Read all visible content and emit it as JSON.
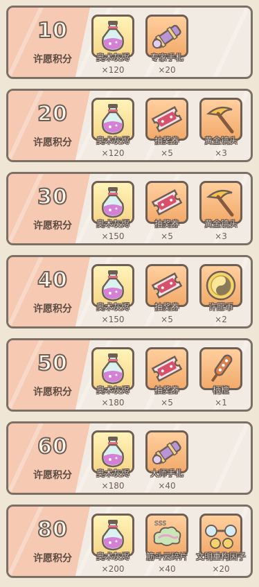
{
  "colors": {
    "panel_border": "#7b6f66",
    "panel_bg": "#f2ebe3",
    "accent_left": "#f5c9b2",
    "gold_box": "#f6d78a",
    "orange_box": "#f2aa6b"
  },
  "tier_label": "许愿积分",
  "tiers": [
    {
      "points": "10",
      "label": "许愿积分",
      "rewards": [
        {
          "name": "奥术灰烬",
          "qty": "×120",
          "icon": "potion-bottle-icon",
          "box": "gold"
        },
        {
          "name": "专家手札",
          "qty": "×20",
          "icon": "scroll-telescope-icon",
          "box": "orange"
        }
      ]
    },
    {
      "points": "20",
      "label": "许愿积分",
      "rewards": [
        {
          "name": "奥术灰烬",
          "qty": "×120",
          "icon": "potion-bottle-icon",
          "box": "gold"
        },
        {
          "name": "抽奖券",
          "qty": "×5",
          "icon": "ticket-icon",
          "box": "orange"
        },
        {
          "name": "黄金镐头",
          "qty": "×3",
          "icon": "pickaxe-icon",
          "box": "orange"
        }
      ]
    },
    {
      "points": "30",
      "label": "许愿积分",
      "rewards": [
        {
          "name": "奥术灰烬",
          "qty": "×150",
          "icon": "potion-bottle-icon",
          "box": "gold"
        },
        {
          "name": "抽奖券",
          "qty": "×5",
          "icon": "ticket-icon",
          "box": "orange"
        },
        {
          "name": "黄金镐头",
          "qty": "×3",
          "icon": "pickaxe-icon",
          "box": "orange"
        }
      ]
    },
    {
      "points": "40",
      "label": "许愿积分",
      "rewards": [
        {
          "name": "奥术灰烬",
          "qty": "×150",
          "icon": "potion-bottle-icon",
          "box": "gold"
        },
        {
          "name": "抽奖券",
          "qty": "×5",
          "icon": "ticket-icon",
          "box": "orange"
        },
        {
          "name": "许愿币",
          "qty": "×2",
          "icon": "coin-icon",
          "box": "orange"
        }
      ]
    },
    {
      "points": "50",
      "label": "许愿积分",
      "rewards": [
        {
          "name": "奥术灰烬",
          "qty": "×180",
          "icon": "potion-bottle-icon",
          "box": "gold"
        },
        {
          "name": "抽奖券",
          "qty": "×5",
          "icon": "ticket-icon",
          "box": "orange"
        },
        {
          "name": "柄檀",
          "qty": "×1",
          "icon": "stick-icon",
          "box": "orange"
        }
      ]
    },
    {
      "points": "60",
      "label": "许愿积分",
      "rewards": [
        {
          "name": "奥术灰烬",
          "qty": "×180",
          "icon": "potion-bottle-icon",
          "box": "gold"
        },
        {
          "name": "大师手札",
          "qty": "×40",
          "icon": "scroll-telescope-icon",
          "box": "orange"
        }
      ]
    },
    {
      "points": "80",
      "label": "许愿积分",
      "rewards": [
        {
          "name": "奥术灰烬",
          "qty": "×200",
          "icon": "potion-bottle-icon",
          "box": "gold"
        },
        {
          "name": "筋斗云碎片",
          "qty": "×40",
          "icon": "cloud-fragment-icon",
          "box": "orange"
        },
        {
          "name": "文明重构因子",
          "qty": "×20",
          "icon": "dumbbell-orb-icon",
          "box": "orange"
        }
      ]
    }
  ]
}
